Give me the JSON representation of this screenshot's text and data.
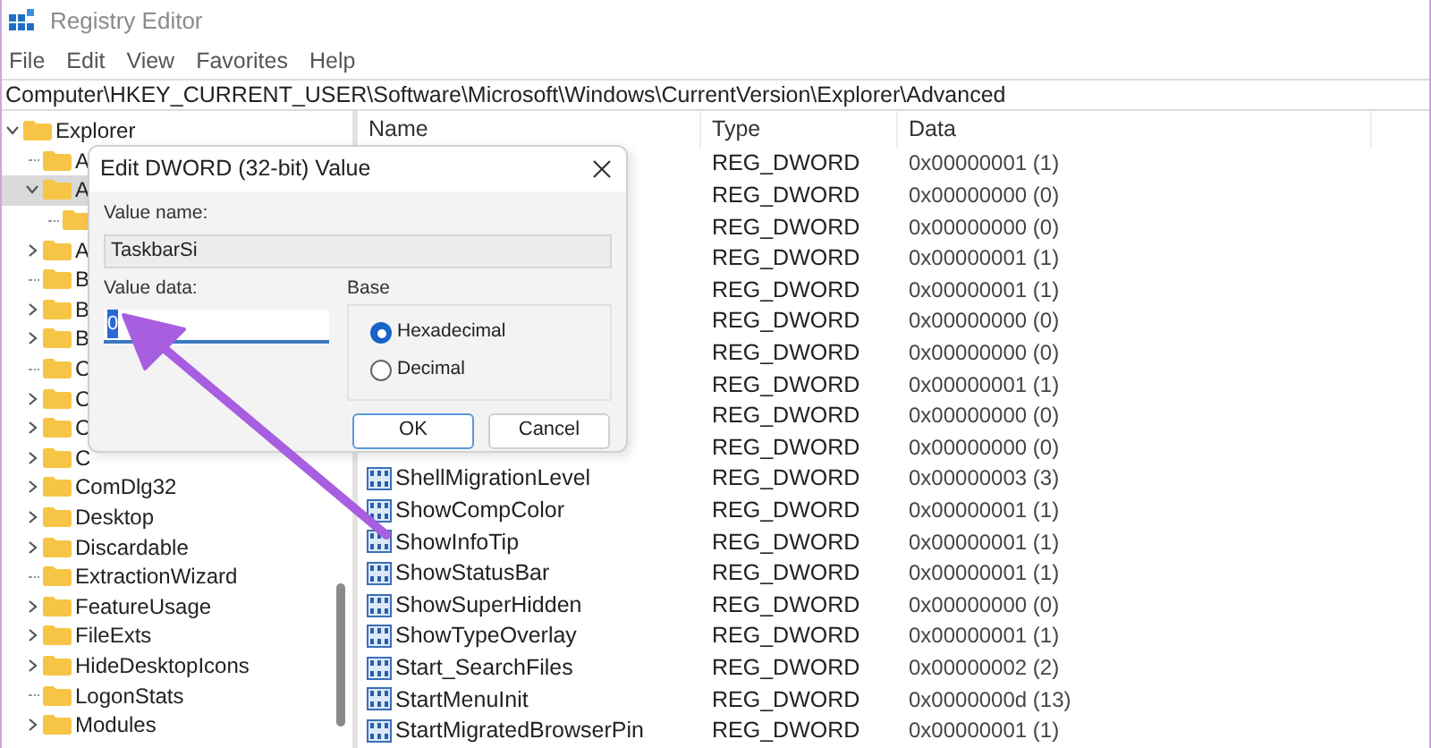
{
  "window": {
    "title": "Registry Editor"
  },
  "menu": [
    "File",
    "Edit",
    "View",
    "Favorites",
    "Help"
  ],
  "address": "Computer\\HKEY_CURRENT_USER\\Software\\Microsoft\\Windows\\CurrentVersion\\Explorer\\Advanced",
  "tree": {
    "label": "Explorer",
    "expanded": true,
    "selected": false,
    "children": [
      {
        "label": "A",
        "selected": false
      },
      {
        "label": "A",
        "expanded": true,
        "selected": true,
        "children": [
          {
            "selected": false
          }
        ]
      },
      {
        "label": "A",
        "expanded": false,
        "selected": false
      },
      {
        "label": "B",
        "selected": false
      },
      {
        "label": "B",
        "expanded": false,
        "selected": false
      },
      {
        "label": "B",
        "expanded": false,
        "selected": false
      },
      {
        "label": "C",
        "selected": false
      },
      {
        "label": "C",
        "expanded": false,
        "selected": false
      },
      {
        "label": "C",
        "expanded": false,
        "selected": false
      },
      {
        "label": "C",
        "expanded": false,
        "selected": false
      },
      {
        "label": "ComDlg32",
        "expanded": false,
        "selected": false
      },
      {
        "label": "Desktop",
        "expanded": false,
        "selected": false
      },
      {
        "label": "Discardable",
        "expanded": false,
        "selected": false
      },
      {
        "label": "ExtractionWizard",
        "selected": false
      },
      {
        "label": "FeatureUsage",
        "expanded": false,
        "selected": false
      },
      {
        "label": "FileExts",
        "expanded": false,
        "selected": false
      },
      {
        "label": "HideDesktopIcons",
        "expanded": false,
        "selected": false
      },
      {
        "label": "LogonStats",
        "selected": false
      },
      {
        "label": "Modules",
        "expanded": false,
        "selected": false
      }
    ]
  },
  "table": {
    "columns": [
      "Name",
      "Type",
      "Data"
    ],
    "rows": [
      {
        "type": "REG_DWORD",
        "data": "0x00000001 (1)"
      },
      {
        "type": "REG_DWORD",
        "data": "0x00000000 (0)"
      },
      {
        "type": "REG_DWORD",
        "data": "0x00000000 (0)"
      },
      {
        "type": "REG_DWORD",
        "data": "0x00000001 (1)"
      },
      {
        "type": "REG_DWORD",
        "data": "0x00000001 (1)"
      },
      {
        "type": "REG_DWORD",
        "data": "0x00000000 (0)"
      },
      {
        "type": "REG_DWORD",
        "data": "0x00000000 (0)"
      },
      {
        "type": "REG_DWORD",
        "data": "0x00000001 (1)"
      },
      {
        "type": "REG_DWORD",
        "data": "0x00000000 (0)"
      },
      {
        "type": "REG_DWORD",
        "data": "0x00000000 (0)"
      },
      {
        "name": "ShellMigrationLevel",
        "type": "REG_DWORD",
        "data": "0x00000003 (3)"
      },
      {
        "name": "ShowCompColor",
        "type": "REG_DWORD",
        "data": "0x00000001 (1)"
      },
      {
        "name": "ShowInfoTip",
        "type": "REG_DWORD",
        "data": "0x00000001 (1)"
      },
      {
        "name": "ShowStatusBar",
        "type": "REG_DWORD",
        "data": "0x00000001 (1)"
      },
      {
        "name": "ShowSuperHidden",
        "type": "REG_DWORD",
        "data": "0x00000000 (0)"
      },
      {
        "name": "ShowTypeOverlay",
        "type": "REG_DWORD",
        "data": "0x00000001 (1)"
      },
      {
        "name": "Start_SearchFiles",
        "type": "REG_DWORD",
        "data": "0x00000002 (2)"
      },
      {
        "name": "StartMenuInit",
        "type": "REG_DWORD",
        "data": "0x0000000d (13)"
      },
      {
        "name": "StartMigratedBrowserPin",
        "type": "REG_DWORD",
        "data": "0x00000001 (1)"
      }
    ]
  },
  "dialog": {
    "title": "Edit DWORD (32-bit) Value",
    "value_name_label": "Value name:",
    "value_name": "TaskbarSi",
    "value_data_label": "Value data:",
    "value_data": "0",
    "base_label": "Base",
    "radios": [
      {
        "label": "Hexadecimal",
        "selected": true
      },
      {
        "label": "Decimal",
        "selected": false
      }
    ],
    "buttons": [
      {
        "label": "OK",
        "default": true
      },
      {
        "label": "Cancel",
        "default": false
      }
    ]
  }
}
